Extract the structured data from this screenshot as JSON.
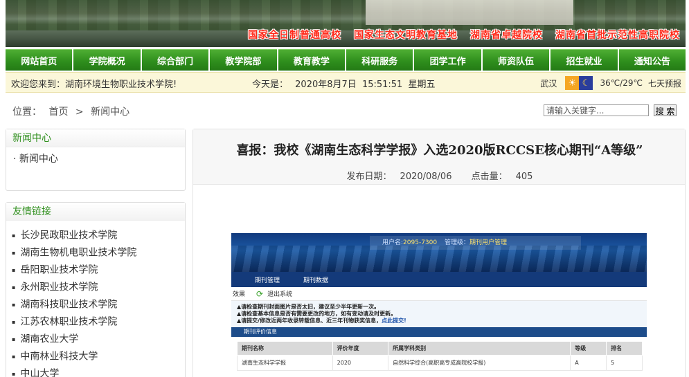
{
  "banner": {
    "slogans": [
      "国家全日制普通高校",
      "国家生态文明教育基地",
      "湖南省卓越院校",
      "湖南省首批示范性高职院校"
    ]
  },
  "nav": {
    "items": [
      "网站首页",
      "学院概况",
      "综合部门",
      "教学院部",
      "教育教学",
      "科研服务",
      "团学工作",
      "师资队伍",
      "招生就业",
      "通知公告"
    ]
  },
  "infobar": {
    "welcome": "欢迎您来到：湖南环境生物职业技术学院!",
    "today_label": "今天是：",
    "date": "2020年8月7日",
    "time": "15:51:51",
    "weekday": "星期五",
    "city": "武汉",
    "temp": "36℃/29℃",
    "forecast_link": "七天预报"
  },
  "location": {
    "label": "位置：",
    "home": "首页",
    "sep": ">",
    "current": "新闻中心"
  },
  "search": {
    "placeholder": "请输入关键字...",
    "button": "搜 索"
  },
  "sidebar": {
    "news": {
      "title": "新闻中心",
      "item": "· 新闻中心"
    },
    "links": {
      "title": "友情链接",
      "items": [
        "长沙民政职业技术学院",
        "湖南生物机电职业技术学院",
        "岳阳职业技术学院",
        "永州职业技术学院",
        "湖南科技职业技术学院",
        "江苏农林职业技术学院",
        "湖南农业大学",
        "中南林业科技大学",
        "中山大学"
      ]
    }
  },
  "article": {
    "title": "喜报：我校《湖南生态科学学报》入选2020版RCCSE核心期刊“A等级”",
    "publish_label": "发布日期：",
    "publish_date": "2020/08/06",
    "clicks_label": "点击量：",
    "clicks": "405"
  },
  "screenshot": {
    "user_label": "用户名:",
    "user_value": "2095-7300",
    "role_label": "管理级：",
    "role_value": "期刊用户管理",
    "tabs": [
      "期刊管理",
      "期刊数据"
    ],
    "tool_left": "效果",
    "tool_exit": "退出系统",
    "notes": [
      "▲请检查期刊封面图片是否太旧，建议至少半年更新一次。",
      "▲请检查基本信息是否有需要更改的地方，如有变动请及时更新。",
      "▲请提交/修改近两年收录转载信息、近三年刊物获奖信息，"
    ],
    "notes_link": "点此提交!",
    "bar_title": "期刊评价信息",
    "table": {
      "headers": [
        "期刊名称",
        "评价年度",
        "所属学科类别",
        "等级",
        "排名"
      ],
      "row": [
        "湖南生态科学学报",
        "2020",
        "自然科学综合(高职高专成高院校学报)",
        "A",
        "5"
      ]
    }
  }
}
